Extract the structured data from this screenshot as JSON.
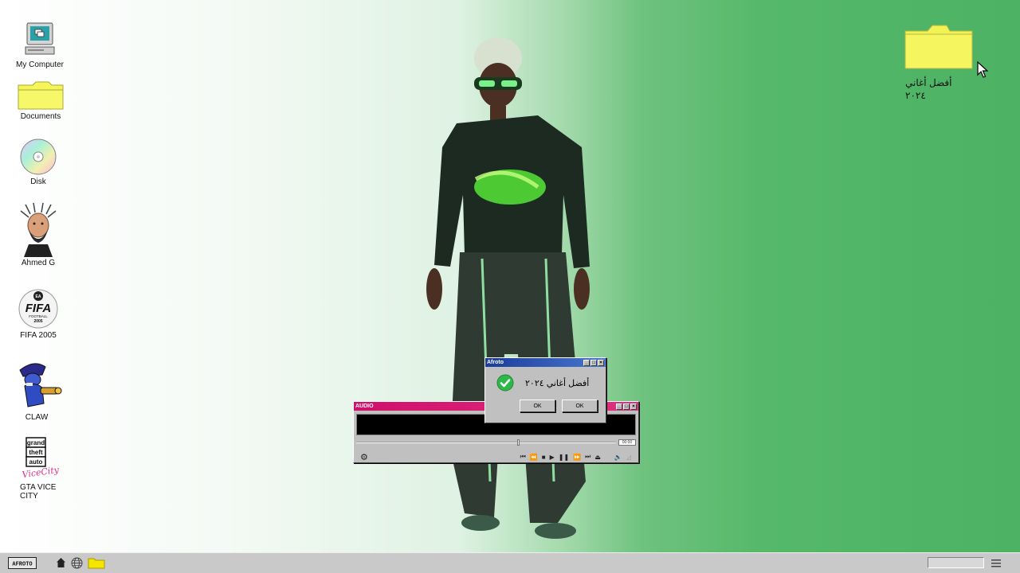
{
  "desktop": {
    "icons": [
      {
        "label": "My Computer",
        "icon": "computer-icon"
      },
      {
        "label": "Documents",
        "icon": "folder-icon"
      },
      {
        "label": "Disk",
        "icon": "cd-icon"
      },
      {
        "label": "Ahmed G",
        "icon": "avatar-icon"
      },
      {
        "label": "FIFA 2005",
        "icon": "fifa-logo-icon"
      },
      {
        "label": "CLAW",
        "icon": "claw-game-icon"
      },
      {
        "label": "GTA VICE CITY",
        "icon": "gta-logo-icon"
      }
    ],
    "right_folder": {
      "label_line1": "أفضل أغاني",
      "label_line2": "٢٠٢٤",
      "icon": "folder-icon"
    }
  },
  "audio_player": {
    "title": "AUDIO",
    "time": "00:00",
    "progress_fraction": 0.62,
    "title_color": "#d0106a"
  },
  "dialog": {
    "title": "Afroto",
    "message": "أفضل أغاني ٢٠٢٤",
    "ok1": "OK",
    "ok2": "OK",
    "icon": "check-icon",
    "title_color": "#1a3c9a"
  },
  "taskbar": {
    "start_label": "AFROTO",
    "icons": [
      "home-icon",
      "globe-icon",
      "folder-icon",
      "menu-icon"
    ]
  },
  "colors": {
    "accent_green": "#4db264",
    "folder_yellow": "#f5f55a"
  }
}
